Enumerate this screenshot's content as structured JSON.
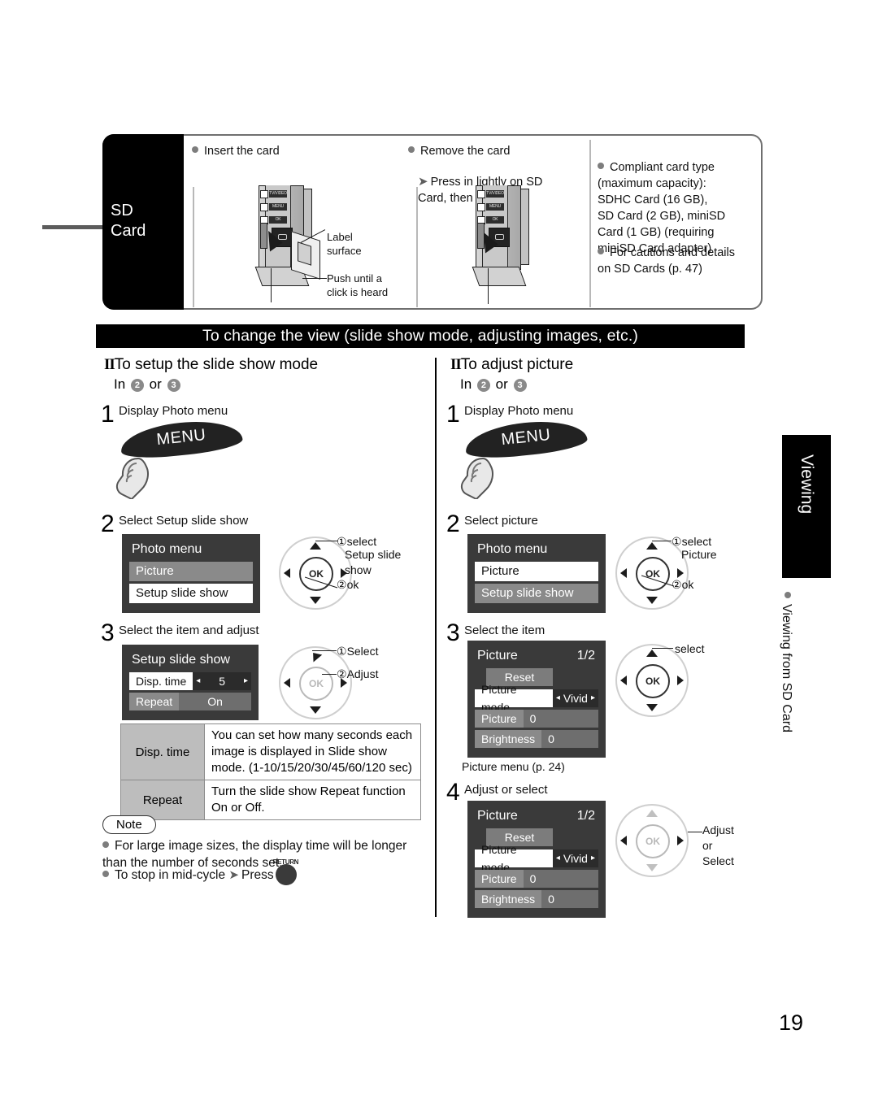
{
  "page": {
    "number": "19"
  },
  "sd_panel": {
    "tab_label_line1": "SD",
    "tab_label_line2": "Card",
    "col1": {
      "heading": "Insert the card",
      "callout_label": "Label\nsurface",
      "callout_push": "Push until a\nclick is heard",
      "device_buttons": [
        "TV/VIDEO",
        "MENU",
        "OK"
      ]
    },
    "col2": {
      "heading": "Remove the card",
      "sub": "Press in lightly on SD\nCard, then release.",
      "device_buttons": [
        "TV/VIDEO",
        "MENU",
        "OK"
      ]
    },
    "col3": {
      "bullet1": "Compliant card type\n(maximum capacity):\nSDHC Card (16 GB),\nSD Card (2 GB), miniSD\nCard (1 GB) (requiring\nminiSD Card adapter)",
      "bullet2": "For cautions and details\non SD Cards (p. 47)"
    }
  },
  "title_bar": {
    "text": "To change the view (slide show mode, adjusting images, etc.)"
  },
  "left_column": {
    "roman": "II",
    "heading": "To setup the slide show mode",
    "sub_prefix": "In",
    "sub_a": "2",
    "sub_or": "or",
    "sub_b": "3",
    "step1": {
      "no": "1",
      "text": "Display  Photo menu",
      "button": "MENU"
    },
    "step2": {
      "no": "2",
      "text": "Select  Setup slide show",
      "osd": {
        "title": "Photo menu",
        "rows": [
          {
            "label": "Picture",
            "state": "gray"
          },
          {
            "label": "Setup slide show",
            "state": "highlight"
          }
        ]
      },
      "wheel": {
        "note1_num": "①",
        "note1": "select",
        "note1_sub": "Setup slide\nshow",
        "note2_num": "②",
        "note2": "ok"
      }
    },
    "step3": {
      "no": "3",
      "text": "Select the item and adjust",
      "osd": {
        "title": "Setup slide show",
        "rows": [
          {
            "label": "Disp. time",
            "value": "5",
            "state": "selected"
          },
          {
            "label": "Repeat",
            "value": "On",
            "state": "gray"
          }
        ]
      },
      "wheel": {
        "note1_num": "①",
        "note1": "Select",
        "note2_num": "②",
        "note2": "Adjust"
      }
    },
    "desc_table": [
      {
        "key": "Disp. time",
        "value": "You can set how many seconds each image is displayed in Slide show mode. (1-10/15/20/30/45/60/120 sec)"
      },
      {
        "key": "Repeat",
        "value": "Turn the slide show Repeat function On or Off."
      }
    ],
    "note": {
      "label": "Note",
      "items": [
        "For large image sizes, the display time will be longer than the number of seconds set.",
        "To stop in mid-cycle"
      ],
      "press_word": "Press",
      "return_label": "RETURN"
    }
  },
  "right_column": {
    "roman": "II",
    "heading": "To adjust picture",
    "sub_prefix": "In",
    "sub_a": "2",
    "sub_or": "or",
    "sub_b": "3",
    "step1": {
      "no": "1",
      "text": "Display  Photo menu",
      "button": "MENU"
    },
    "step2": {
      "no": "2",
      "text": "Select  picture",
      "osd": {
        "title": "Photo menu",
        "rows": [
          {
            "label": "Picture",
            "state": "highlight"
          },
          {
            "label": "Setup slide show",
            "state": "gray"
          }
        ]
      },
      "wheel": {
        "note1_num": "①",
        "note1": "select",
        "note1_sub": "Picture",
        "note2_num": "②",
        "note2": "ok"
      }
    },
    "step3": {
      "no": "3",
      "text": "Select the item",
      "osd": {
        "title": "Picture",
        "page": "1/2",
        "reset": "Reset",
        "rows": [
          {
            "label": "Picture mode",
            "value": "Vivid",
            "state": "selected"
          },
          {
            "label": "Picture",
            "value": "0",
            "state": "gray"
          },
          {
            "label": "Brightness",
            "value": "0",
            "state": "gray"
          }
        ]
      },
      "caption": "Picture menu (p. 24)",
      "wheel": {
        "note1": "select"
      }
    },
    "step4": {
      "no": "4",
      "text": "Adjust or select",
      "osd": {
        "title": "Picture",
        "page": "1/2",
        "reset": "Reset",
        "rows": [
          {
            "label": "Picture mode",
            "value": "Vivid",
            "state": "selected"
          },
          {
            "label": "Picture",
            "value": "0",
            "state": "gray"
          },
          {
            "label": "Brightness",
            "value": "0",
            "state": "gray"
          }
        ]
      },
      "wheel": {
        "note1": "Adjust\nor\nSelect"
      }
    }
  },
  "side_tab": {
    "label": "Viewing",
    "sub": "Viewing from SD Card"
  }
}
